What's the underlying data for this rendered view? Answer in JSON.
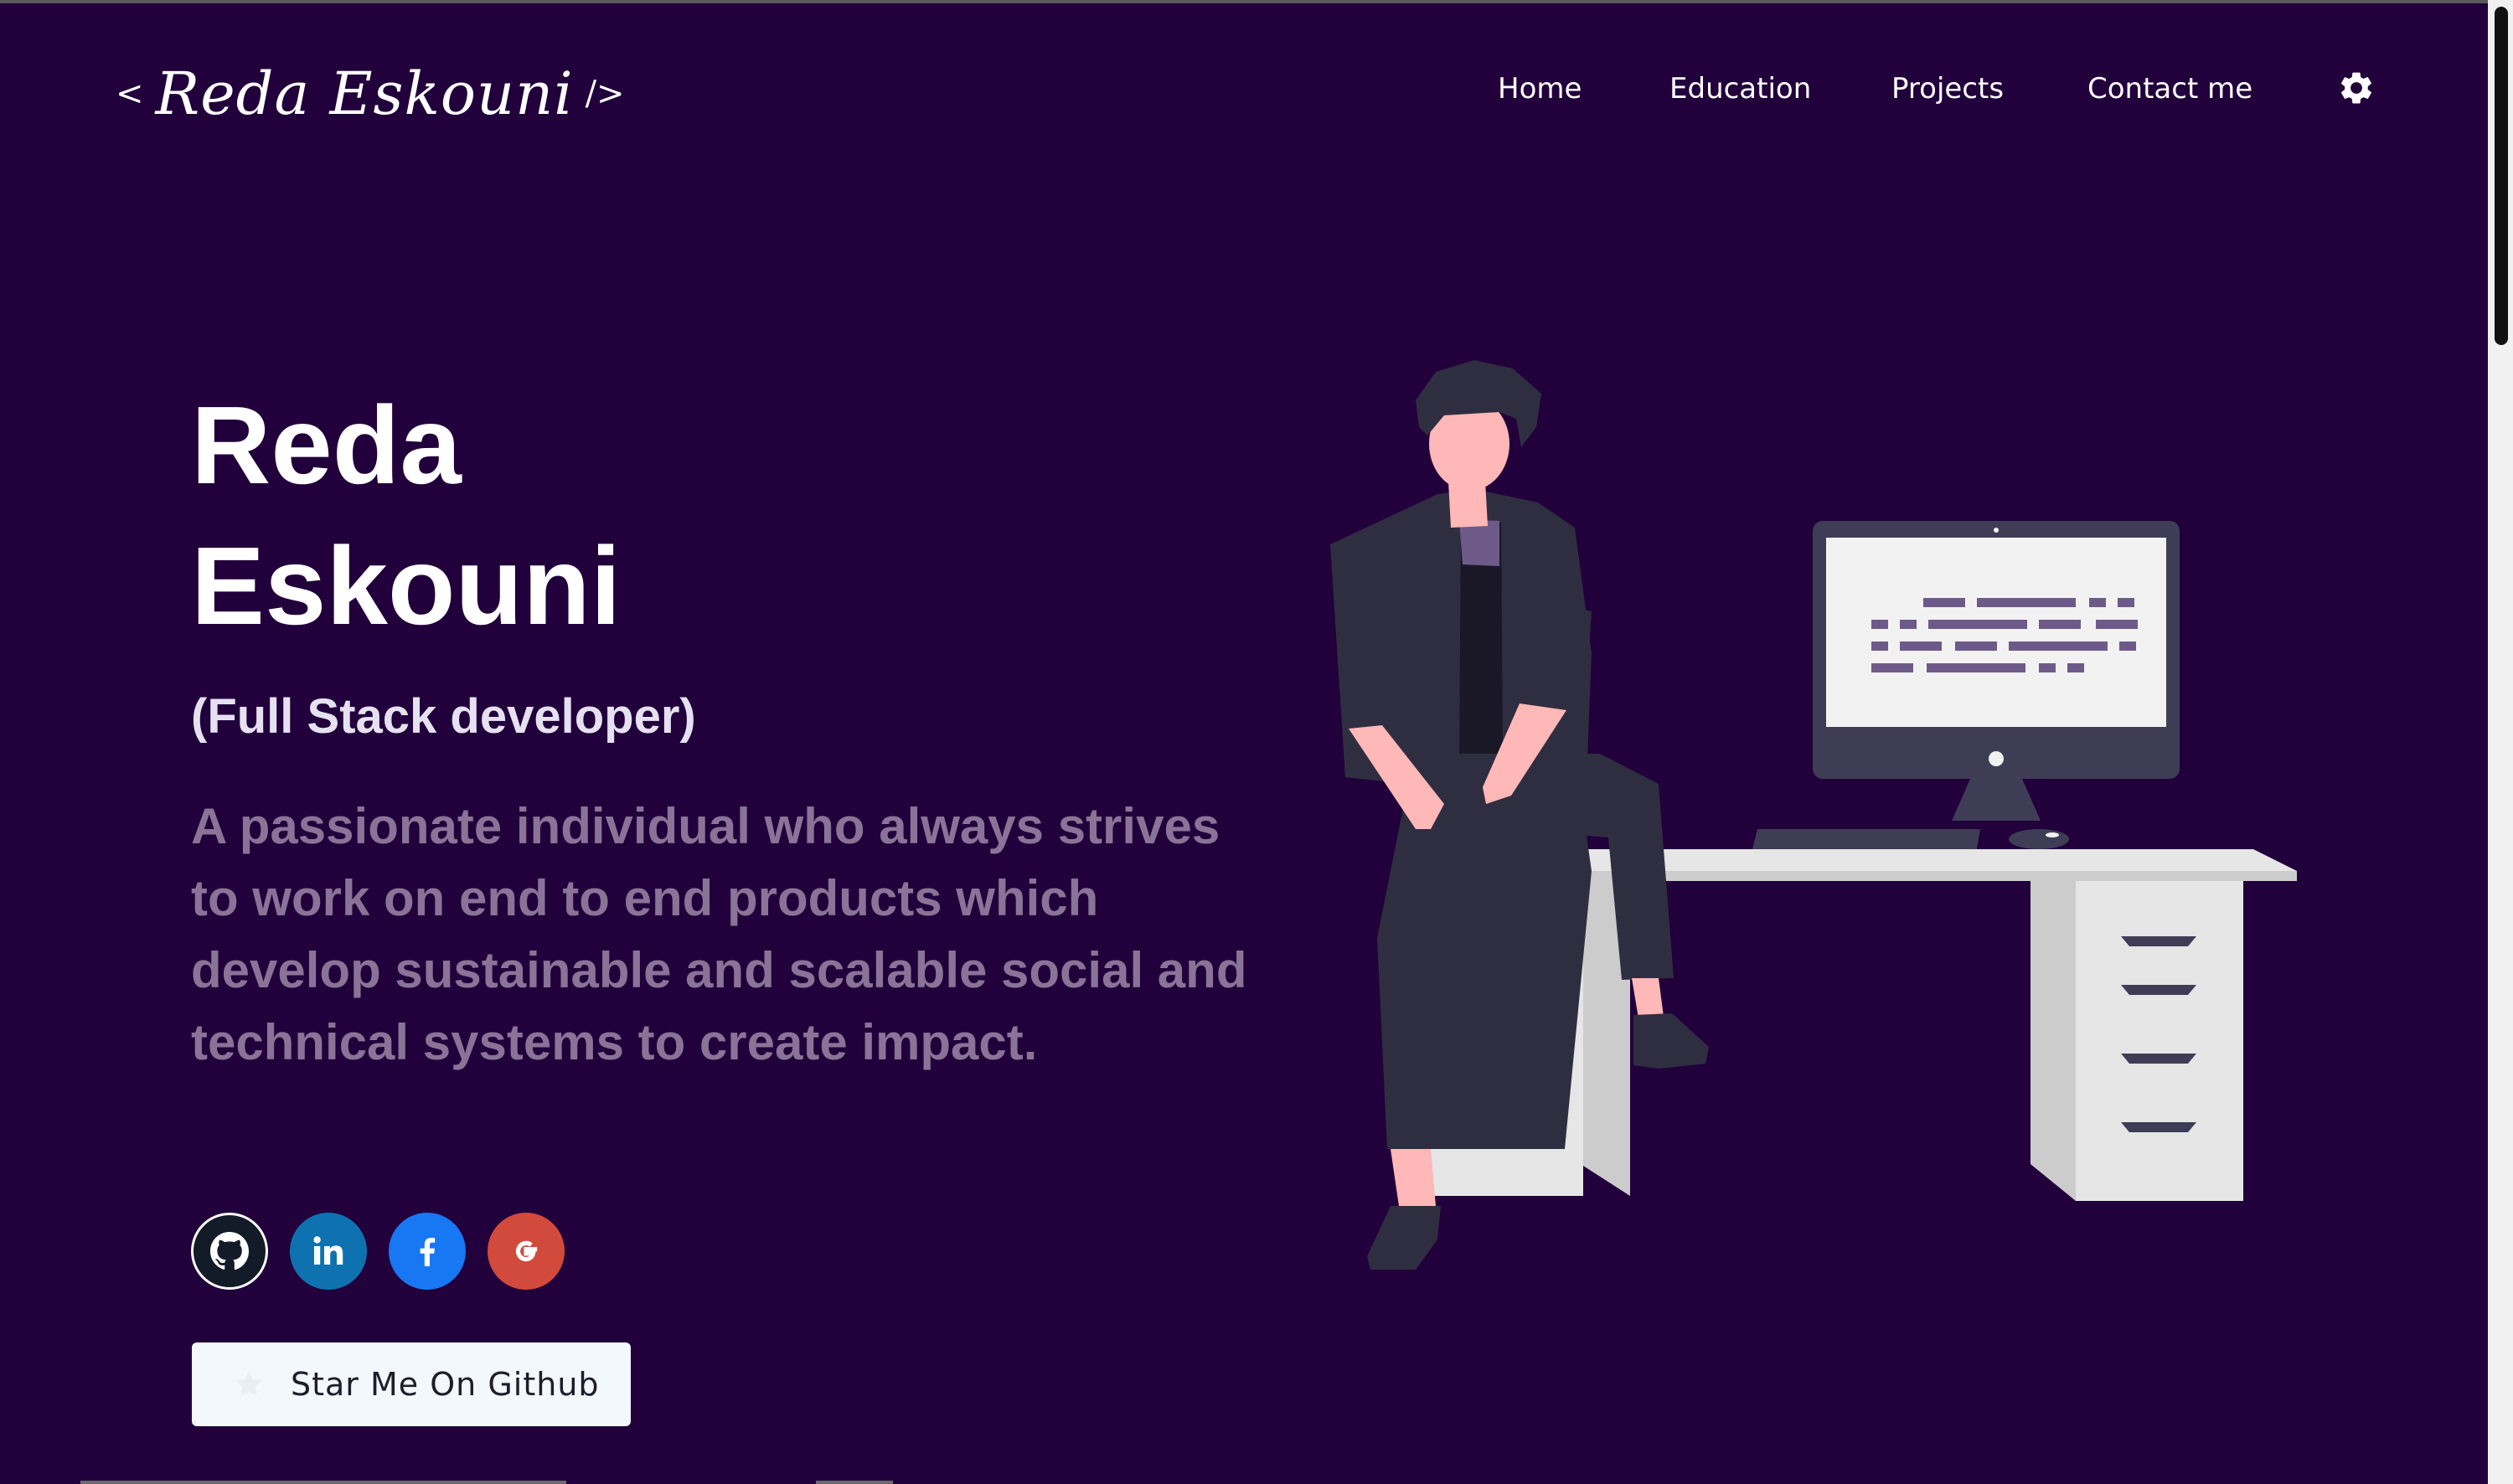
{
  "header": {
    "logo": {
      "open": "<",
      "name": "Reda Eskouni",
      "close": "/>"
    },
    "nav": [
      "Home",
      "Education",
      "Projects",
      "Contact me"
    ],
    "settings_icon": "gear-icon"
  },
  "hero": {
    "first_name": "Reda",
    "last_name": "Eskouni",
    "role": "(Full Stack developer)",
    "bio": "A passionate individual who always strives to work on end to end products which develop sustainable and scalable social and technical systems to create impact.",
    "socials": [
      {
        "icon": "github-icon",
        "color": "#131a28"
      },
      {
        "icon": "linkedin-icon",
        "color": "#0e72b1"
      },
      {
        "icon": "facebook-icon",
        "color": "#1877f2"
      },
      {
        "icon": "google-icon",
        "color": "#d24a3c"
      }
    ],
    "star_button": {
      "label": "Star Me On Github",
      "icon": "star-icon"
    }
  },
  "illustration": {
    "icon": "developer-at-desk-illustration"
  },
  "colors": {
    "background": "#21003b",
    "bio_text": "#8a7397",
    "button_bg": "#f3f8fd"
  }
}
